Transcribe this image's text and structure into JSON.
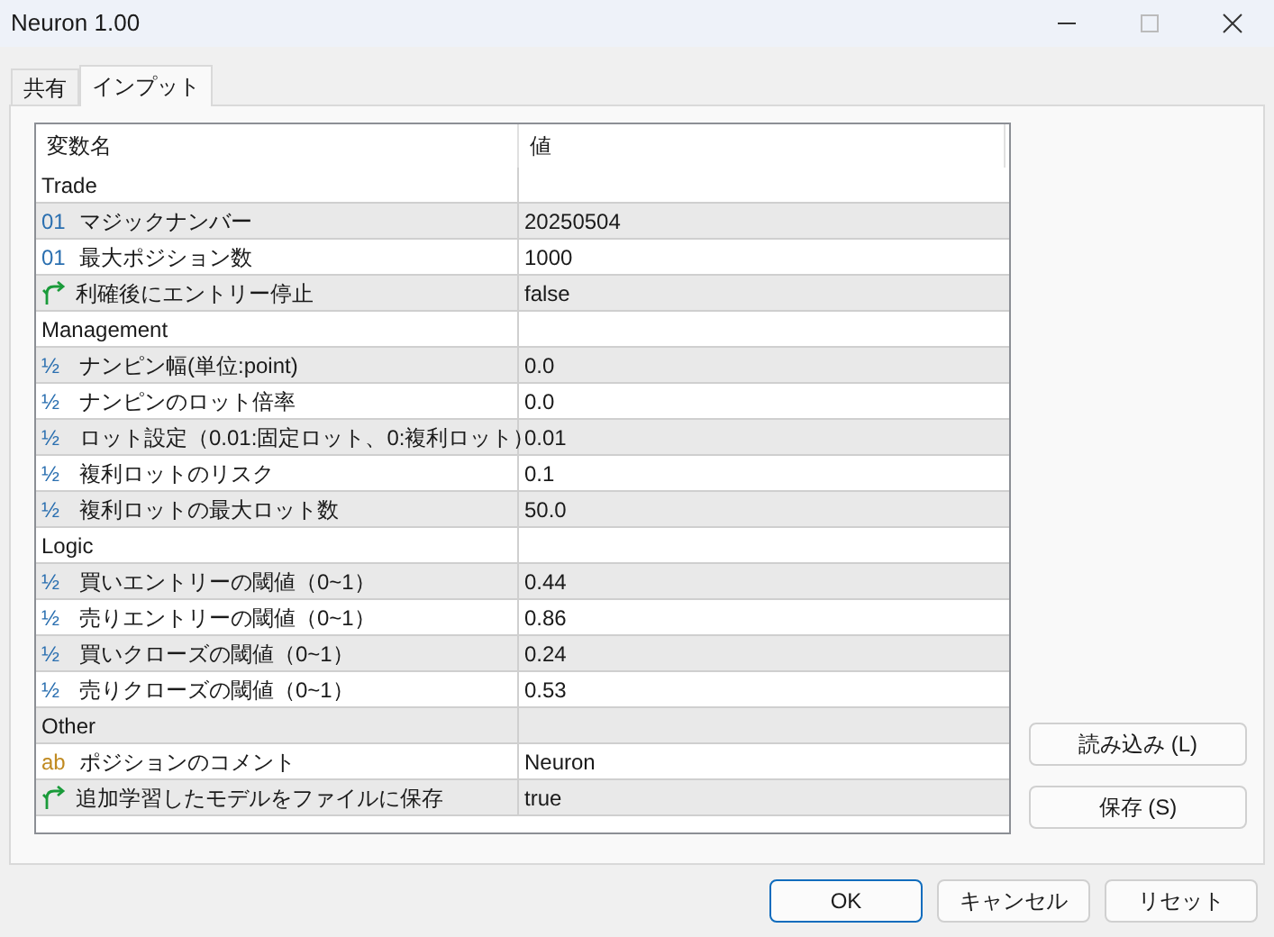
{
  "window": {
    "title": "Neuron 1.00"
  },
  "tabs": [
    {
      "label": "共有",
      "selected": false
    },
    {
      "label": "インプット",
      "selected": true
    }
  ],
  "table": {
    "columns": [
      "変数名",
      "値"
    ],
    "rows": [
      {
        "kind": "group",
        "name": "Trade",
        "value": ""
      },
      {
        "kind": "int",
        "icon": "01",
        "name": "マジックナンバー",
        "value": "20250504"
      },
      {
        "kind": "int",
        "icon": "01",
        "name": "最大ポジション数",
        "value": "1000"
      },
      {
        "kind": "bool",
        "name": "利確後にエントリー停止",
        "value": "false"
      },
      {
        "kind": "group",
        "name": "Management",
        "value": ""
      },
      {
        "kind": "double",
        "icon": "½",
        "name": "ナンピン幅(単位:point)",
        "value": "0.0"
      },
      {
        "kind": "double",
        "icon": "½",
        "name": "ナンピンのロット倍率",
        "value": "0.0"
      },
      {
        "kind": "double",
        "icon": "½",
        "name": "ロット設定（0.01:固定ロット、0:複利ロット）",
        "value": "0.01"
      },
      {
        "kind": "double",
        "icon": "½",
        "name": "複利ロットのリスク",
        "value": "0.1"
      },
      {
        "kind": "double",
        "icon": "½",
        "name": "複利ロットの最大ロット数",
        "value": "50.0"
      },
      {
        "kind": "group",
        "name": "Logic",
        "value": ""
      },
      {
        "kind": "double",
        "icon": "½",
        "name": "買いエントリーの閾値（0~1）",
        "value": "0.44"
      },
      {
        "kind": "double",
        "icon": "½",
        "name": "売りエントリーの閾値（0~1）",
        "value": "0.86"
      },
      {
        "kind": "double",
        "icon": "½",
        "name": "買いクローズの閾値（0~1）",
        "value": "0.24"
      },
      {
        "kind": "double",
        "icon": "½",
        "name": "売りクローズの閾値（0~1）",
        "value": "0.53"
      },
      {
        "kind": "group",
        "name": "Other",
        "value": ""
      },
      {
        "kind": "string",
        "icon": "ab",
        "name": "ポジションのコメント",
        "value": "Neuron"
      },
      {
        "kind": "bool",
        "name": "追加学習したモデルをファイルに保存",
        "value": "true"
      }
    ]
  },
  "side_buttons": [
    "読み込み (L)",
    "保存 (S)"
  ],
  "footer_buttons": [
    {
      "label": "OK",
      "default": true
    },
    {
      "label": "キャンセル",
      "default": false
    },
    {
      "label": "リセット",
      "default": false
    }
  ]
}
